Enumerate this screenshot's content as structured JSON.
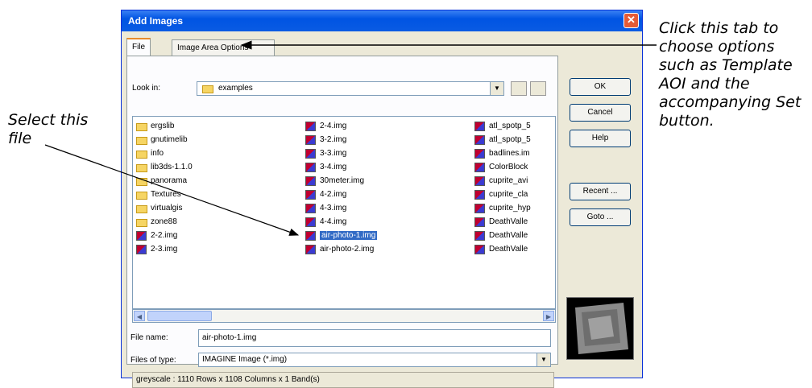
{
  "callouts": {
    "right": "Click this tab to choose options such as Template AOI and the accompanying Set button.",
    "left": "Select this file"
  },
  "dialog": {
    "title": "Add Images",
    "close_symbol": "✕",
    "tabs": [
      "File",
      "Image Area Options"
    ],
    "look_in_label": "Look in:",
    "look_in_value": "examples",
    "folders": [
      "ergslib",
      "gnutimelib",
      "info",
      "lib3ds-1.1.0",
      "panorama",
      "Textures",
      "virtualgis",
      "zone88"
    ],
    "col1_images": [
      "2-2.img",
      "2-3.img"
    ],
    "col2_images": [
      "2-4.img",
      "3-2.img",
      "3-3.img",
      "3-4.img",
      "30meter.img",
      "4-2.img",
      "4-3.img",
      "4-4.img",
      "air-photo-1.img",
      "air-photo-2.img"
    ],
    "col3_images": [
      "atl_spotp_5",
      "atl_spotp_5",
      "badlines.im",
      "ColorBlock",
      "cuprite_avi",
      "cuprite_cla",
      "cuprite_hyp",
      "DeathValle",
      "DeathValle",
      "DeathValle"
    ],
    "selected_file": "air-photo-1.img",
    "file_name_label": "File name:",
    "file_name_value": "air-photo-1.img",
    "files_of_type_label": "Files of type:",
    "files_of_type_value": "IMAGINE Image (*.img)",
    "status": "greyscale : 1110 Rows x 1108 Columns x 1 Band(s)",
    "buttons": {
      "ok": "OK",
      "cancel": "Cancel",
      "help": "Help",
      "recent": "Recent ...",
      "goto": "Goto ..."
    }
  }
}
